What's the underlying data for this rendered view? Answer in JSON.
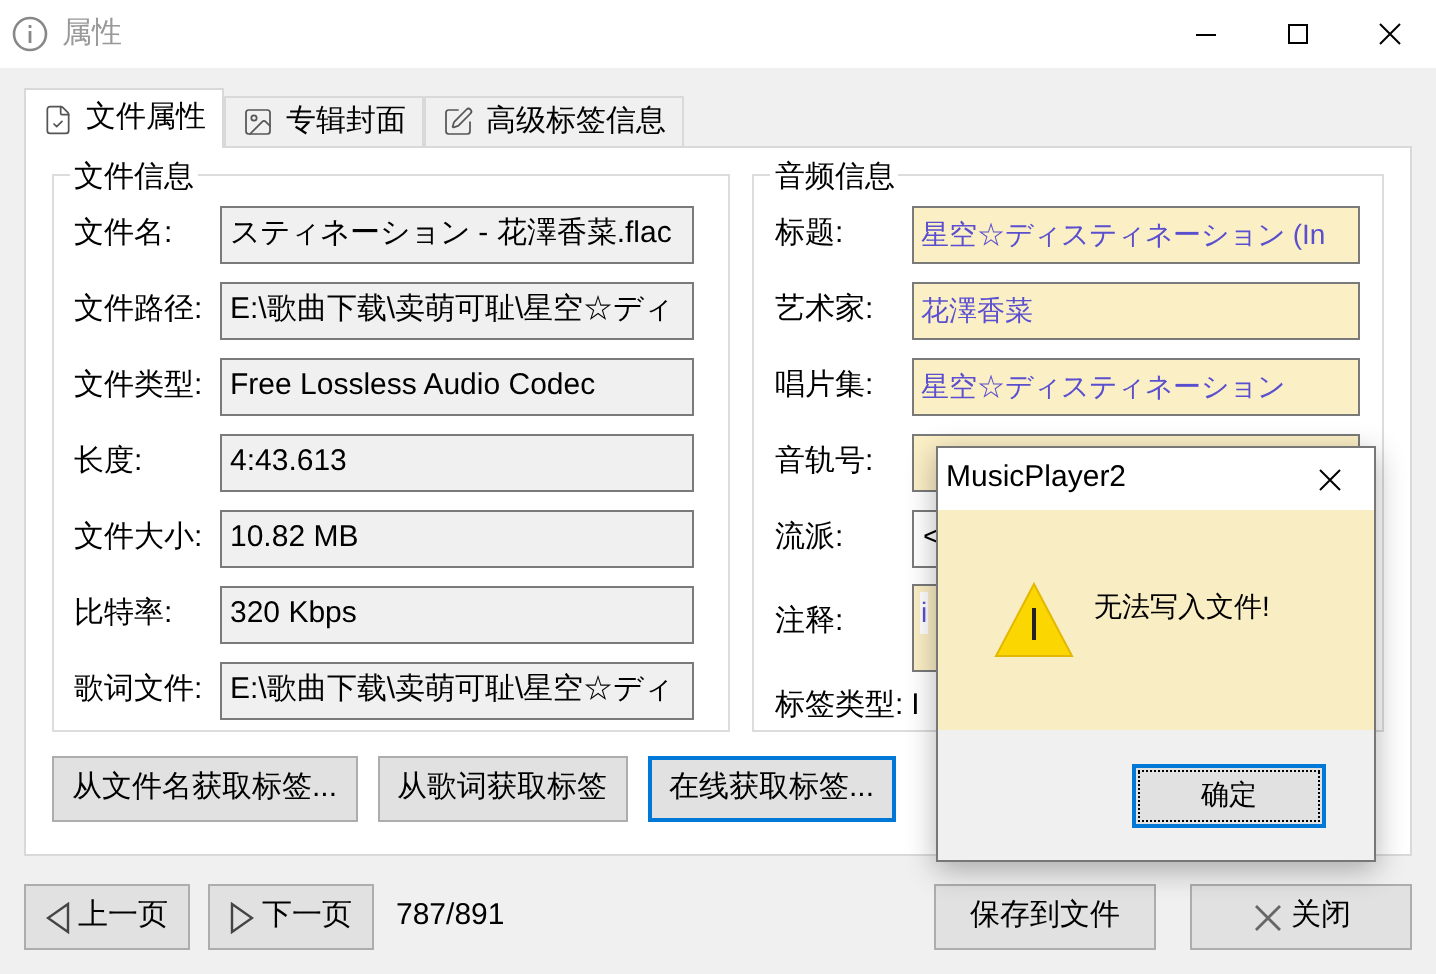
{
  "window": {
    "title": "属性"
  },
  "tabs": [
    {
      "label": "文件属性",
      "selected": true
    },
    {
      "label": "专辑封面",
      "selected": false
    },
    {
      "label": "高级标签信息",
      "selected": false
    }
  ],
  "file_info": {
    "title": "文件信息",
    "rows": [
      {
        "label": "文件名:",
        "value": "スティネーション - 花澤香菜.flac"
      },
      {
        "label": "文件路径:",
        "value": "E:\\歌曲下载\\卖萌可耻\\星空☆ディ"
      },
      {
        "label": "文件类型:",
        "value": "Free Lossless Audio Codec"
      },
      {
        "label": "长度:",
        "value": "4:43.613"
      },
      {
        "label": "文件大小:",
        "value": "10.82 MB"
      },
      {
        "label": "比特率:",
        "value": "320 Kbps"
      },
      {
        "label": "歌词文件:",
        "value": "E:\\歌曲下载\\卖萌可耻\\星空☆ディ"
      }
    ]
  },
  "audio_info": {
    "title": "音频信息",
    "rows": [
      {
        "label": "标题:",
        "value": "星空☆ディスティネーション (In",
        "kind": "field"
      },
      {
        "label": "艺术家:",
        "value": "花澤香菜",
        "kind": "field"
      },
      {
        "label": "唱片集:",
        "value": "星空☆ディスティネーション",
        "kind": "field"
      },
      {
        "label": "音轨号:",
        "kind": "field"
      },
      {
        "label": "流派:",
        "value": "<",
        "kind": "combo"
      },
      {
        "label": "注释:",
        "value": "i",
        "kind": "memo"
      }
    ],
    "tag_type": {
      "label": "标签类型:",
      "value": "I"
    }
  },
  "actions": [
    "从文件名获取标签...",
    "从歌词获取标签",
    "在线获取标签..."
  ],
  "footer": {
    "prev": "上一页",
    "next": "下一页",
    "counter": "787/891",
    "save": "保存到文件",
    "close": "关闭"
  },
  "dialog": {
    "title": "MusicPlayer2",
    "message": "无法写入文件!",
    "ok": "确定"
  }
}
